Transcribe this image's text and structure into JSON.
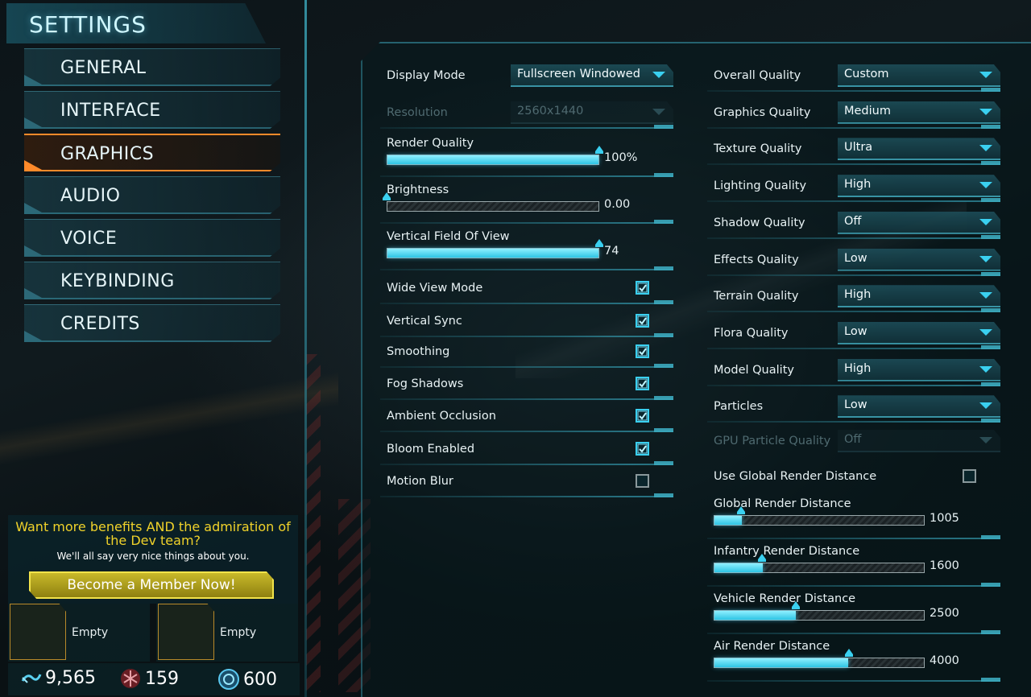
{
  "sidebar": {
    "title": "SETTINGS",
    "items": [
      {
        "label": "GENERAL"
      },
      {
        "label": "INTERFACE"
      },
      {
        "label": "GRAPHICS"
      },
      {
        "label": "AUDIO"
      },
      {
        "label": "VOICE"
      },
      {
        "label": "KEYBINDING"
      },
      {
        "label": "CREDITS"
      }
    ],
    "active": "GRAPHICS"
  },
  "promo": {
    "headline": "Want more benefits AND the admiration of the Dev team?",
    "sub": "We'll all say very nice things about you.",
    "button": "Become a Member Now!"
  },
  "slots": [
    {
      "label": "Empty"
    },
    {
      "label": "Empty"
    }
  ],
  "currency": {
    "certs": "9,565",
    "daybreak": "159",
    "isc": "600"
  },
  "left_settings": {
    "display_mode": {
      "label": "Display Mode",
      "value": "Fullscreen Windowed"
    },
    "resolution": {
      "label": "Resolution",
      "value": "2560x1440"
    },
    "render_quality": {
      "label": "Render Quality",
      "value": "100%",
      "fraction": 1.0
    },
    "brightness": {
      "label": "Brightness",
      "value": "0.00",
      "fraction": 0.0
    },
    "fov": {
      "label": "Vertical Field Of View",
      "value": "74",
      "fraction": 1.0
    },
    "checkboxes": [
      {
        "label": "Wide View Mode",
        "checked": true
      },
      {
        "label": "Vertical Sync",
        "checked": true
      },
      {
        "label": "Smoothing",
        "checked": true
      },
      {
        "label": "Fog Shadows",
        "checked": true
      },
      {
        "label": "Ambient Occlusion",
        "checked": true
      },
      {
        "label": "Bloom Enabled",
        "checked": true
      },
      {
        "label": "Motion Blur",
        "checked": false
      }
    ]
  },
  "right_settings": {
    "dropdowns": [
      {
        "label": "Overall Quality",
        "value": "Custom"
      },
      {
        "label": "Graphics Quality",
        "value": "Medium"
      },
      {
        "label": "Texture Quality",
        "value": "Ultra"
      },
      {
        "label": "Lighting Quality",
        "value": "High"
      },
      {
        "label": "Shadow Quality",
        "value": "Off"
      },
      {
        "label": "Effects Quality",
        "value": "Low"
      },
      {
        "label": "Terrain Quality",
        "value": "High"
      },
      {
        "label": "Flora Quality",
        "value": "Low"
      },
      {
        "label": "Model Quality",
        "value": "High"
      },
      {
        "label": "Particles",
        "value": "Low"
      }
    ],
    "gpu_particle": {
      "label": "GPU Particle Quality",
      "value": "Off"
    },
    "use_global_render": {
      "label": "Use Global Render Distance",
      "checked": false
    },
    "sliders": [
      {
        "label": "Global Render Distance",
        "value": "1005",
        "fraction": 0.13
      },
      {
        "label": "Infantry Render Distance",
        "value": "1600",
        "fraction": 0.23
      },
      {
        "label": "Vehicle Render Distance",
        "value": "2500",
        "fraction": 0.39
      },
      {
        "label": "Air Render Distance",
        "value": "4000",
        "fraction": 0.64
      }
    ]
  },
  "colors": {
    "accent": "#3ad0f0",
    "active_nav": "#ff8a2a",
    "promo_text": "#f0d22a",
    "member_button": "#c9b92a"
  }
}
